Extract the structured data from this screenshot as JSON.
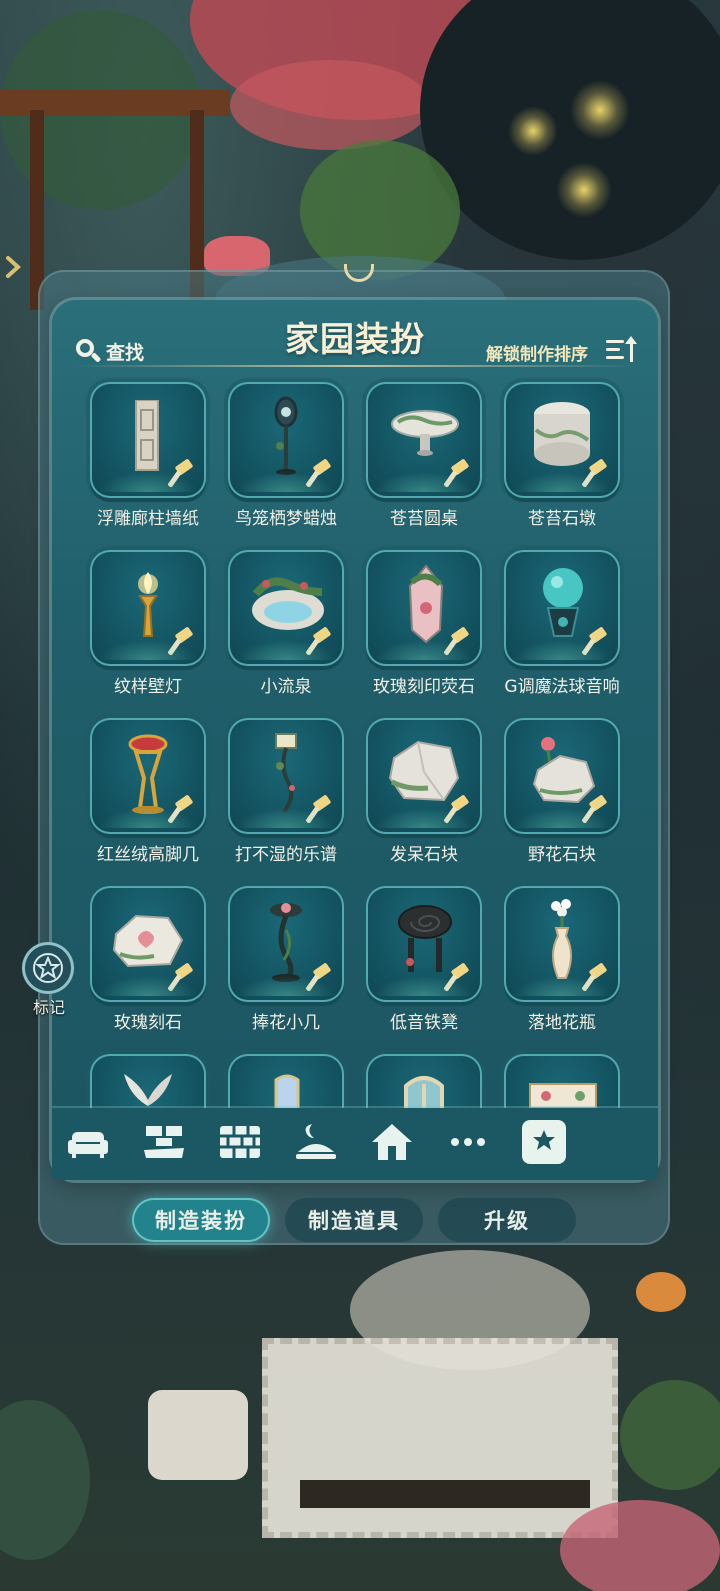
{
  "panel": {
    "title": "家园装扮",
    "search_label": "查找",
    "sort_label": "解锁制作排序"
  },
  "items": [
    {
      "label": "浮雕廊柱墙纸",
      "icon": "relief-column-wallpaper-icon"
    },
    {
      "label": "鸟笼栖梦蜡烛",
      "icon": "birdcage-candle-icon"
    },
    {
      "label": "苍苔圆桌",
      "icon": "moss-round-table-icon"
    },
    {
      "label": "苍苔石墩",
      "icon": "moss-stone-stool-icon"
    },
    {
      "label": "纹样壁灯",
      "icon": "patterned-wall-lamp-icon"
    },
    {
      "label": "小流泉",
      "icon": "small-spring-icon"
    },
    {
      "label": "玫瑰刻印荧石",
      "icon": "rose-fluorite-icon"
    },
    {
      "label": "G调魔法球音响",
      "icon": "magic-orb-speaker-icon"
    },
    {
      "label": "红丝绒高脚几",
      "icon": "velvet-tall-table-icon"
    },
    {
      "label": "打不湿的乐谱",
      "icon": "music-score-stand-icon"
    },
    {
      "label": "发呆石块",
      "icon": "daydream-rock-icon"
    },
    {
      "label": "野花石块",
      "icon": "wildflower-rock-icon"
    },
    {
      "label": "玫瑰刻石",
      "icon": "rose-carved-stone-icon"
    },
    {
      "label": "捧花小几",
      "icon": "bouquet-side-table-icon"
    },
    {
      "label": "低音铁凳",
      "icon": "bass-iron-stool-icon"
    },
    {
      "label": "落地花瓶",
      "icon": "floor-vase-icon"
    },
    {
      "label": "",
      "icon": "wing-ornament-icon"
    },
    {
      "label": "",
      "icon": "mirror-panel-icon"
    },
    {
      "label": "",
      "icon": "ornate-window-icon"
    },
    {
      "label": "",
      "icon": "decorated-cabinet-icon"
    }
  ],
  "categories": [
    {
      "name": "sofa-icon"
    },
    {
      "name": "floor-tile-icon"
    },
    {
      "name": "wall-brick-icon"
    },
    {
      "name": "night-light-icon"
    },
    {
      "name": "house-icon"
    },
    {
      "name": "more-icon"
    },
    {
      "name": "favorite-star-icon",
      "active": true
    }
  ],
  "tabs": [
    {
      "label": "制造装扮",
      "active": true
    },
    {
      "label": "制造道具",
      "active": false
    },
    {
      "label": "升级",
      "active": false
    }
  ],
  "side": {
    "mark_label": "标记"
  },
  "colors": {
    "panel": "#1f5e6a",
    "tile": "#145563",
    "tile_border": "#53a9b0",
    "title_text": "#f7f0d6",
    "active_tab": "#22838c"
  }
}
